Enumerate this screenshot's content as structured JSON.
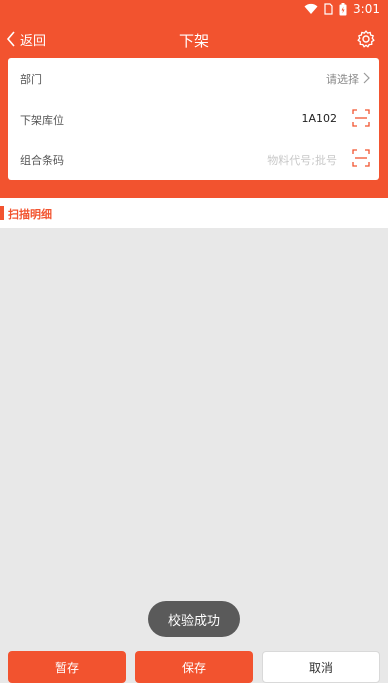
{
  "status_bar": {
    "time": "3:01"
  },
  "nav": {
    "back_label": "返回",
    "title": "下架",
    "settings_icon": "gear-icon"
  },
  "form": {
    "department": {
      "label": "部门",
      "value": "请选择"
    },
    "location": {
      "label": "下架库位",
      "value": "1A102"
    },
    "barcode": {
      "label": "组合条码",
      "placeholder": "物料代号;批号"
    }
  },
  "section": {
    "title": "扫描明细"
  },
  "toast": {
    "text": "校验成功"
  },
  "actions": {
    "temp_save": "暂存",
    "save": "保存",
    "cancel": "取消"
  },
  "colors": {
    "brand": "#f2532f",
    "background": "#e8e8e8"
  }
}
